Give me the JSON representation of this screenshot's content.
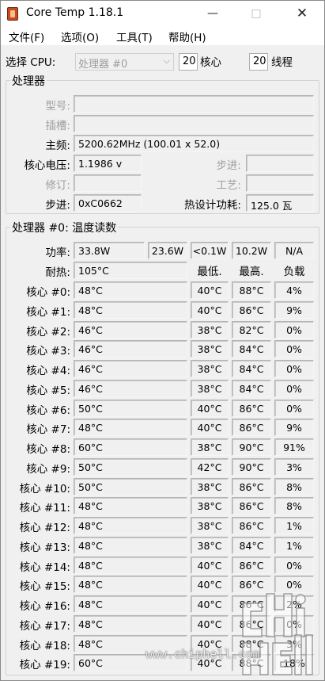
{
  "window": {
    "title": "Core Temp 1.18.1"
  },
  "menu": [
    "文件(F)",
    "选项(O)",
    "工具(T)",
    "帮助(H)"
  ],
  "select_cpu": {
    "label": "选择 CPU:",
    "value": "处理器 #0",
    "cores": "20",
    "cores_label": "核心",
    "threads": "20",
    "threads_label": "线程"
  },
  "processor": {
    "title": "处理器",
    "model_label": "型号:",
    "model": "",
    "socket_label": "插槽:",
    "socket": "",
    "freq_label": "主频:",
    "freq": "5200.62MHz (100.01 x 52.0)",
    "vid_label": "核心电压:",
    "vid": "1.1986 v",
    "stepping_label": "步进:",
    "stepping": "",
    "revision_label": "修订:",
    "revision": "",
    "lithography_label": "工艺:",
    "lithography": "",
    "cpuid_label": "步进:",
    "cpuid": "0xC0662",
    "tdp_label": "热设计功耗:",
    "tdp": "125.0 瓦"
  },
  "temps": {
    "title": "处理器 #0: 温度读数",
    "power_label": "功率:",
    "power": [
      "33.8W",
      "23.6W",
      "<0.1W",
      "10.2W",
      "N/A"
    ],
    "tjmax_label": "耐热:",
    "tjmax": "105°C",
    "col_min": "最低.",
    "col_max": "最高.",
    "col_load": "负载",
    "cores": [
      {
        "label": "核心 #0:",
        "temp": "48°C",
        "min": "40°C",
        "max": "88°C",
        "load": "4%"
      },
      {
        "label": "核心 #1:",
        "temp": "48°C",
        "min": "40°C",
        "max": "86°C",
        "load": "9%"
      },
      {
        "label": "核心 #2:",
        "temp": "46°C",
        "min": "38°C",
        "max": "82°C",
        "load": "0%"
      },
      {
        "label": "核心 #3:",
        "temp": "46°C",
        "min": "38°C",
        "max": "84°C",
        "load": "0%"
      },
      {
        "label": "核心 #4:",
        "temp": "46°C",
        "min": "38°C",
        "max": "84°C",
        "load": "0%"
      },
      {
        "label": "核心 #5:",
        "temp": "46°C",
        "min": "38°C",
        "max": "84°C",
        "load": "0%"
      },
      {
        "label": "核心 #6:",
        "temp": "50°C",
        "min": "40°C",
        "max": "86°C",
        "load": "0%"
      },
      {
        "label": "核心 #7:",
        "temp": "48°C",
        "min": "40°C",
        "max": "86°C",
        "load": "9%"
      },
      {
        "label": "核心 #8:",
        "temp": "60°C",
        "min": "38°C",
        "max": "90°C",
        "load": "91%"
      },
      {
        "label": "核心 #9:",
        "temp": "50°C",
        "min": "42°C",
        "max": "90°C",
        "load": "3%"
      },
      {
        "label": "核心 #10:",
        "temp": "50°C",
        "min": "38°C",
        "max": "86°C",
        "load": "8%"
      },
      {
        "label": "核心 #11:",
        "temp": "48°C",
        "min": "38°C",
        "max": "86°C",
        "load": "8%"
      },
      {
        "label": "核心 #12:",
        "temp": "48°C",
        "min": "38°C",
        "max": "86°C",
        "load": "1%"
      },
      {
        "label": "核心 #13:",
        "temp": "48°C",
        "min": "38°C",
        "max": "84°C",
        "load": "1%"
      },
      {
        "label": "核心 #14:",
        "temp": "48°C",
        "min": "40°C",
        "max": "86°C",
        "load": "0%"
      },
      {
        "label": "核心 #15:",
        "temp": "48°C",
        "min": "40°C",
        "max": "86°C",
        "load": "0%"
      },
      {
        "label": "核心 #16:",
        "temp": "48°C",
        "min": "40°C",
        "max": "86°C",
        "load": "2%"
      },
      {
        "label": "核心 #17:",
        "temp": "48°C",
        "min": "40°C",
        "max": "86°C",
        "load": "0%"
      },
      {
        "label": "核心 #18:",
        "temp": "48°C",
        "min": "40°C",
        "max": "88°C",
        "load": "3%"
      },
      {
        "label": "核心 #19:",
        "temp": "60°C",
        "min": "40°C",
        "max": "88°C",
        "load": "18%"
      }
    ]
  },
  "watermark": {
    "text": "www.chiphell.com",
    "logo": "chip hell"
  },
  "icons": {
    "app": "core-temp-app-icon",
    "minimize": "minimize-icon",
    "maximize": "maximize-icon",
    "close": "close-icon",
    "dropdown": "chevron-down-icon"
  }
}
